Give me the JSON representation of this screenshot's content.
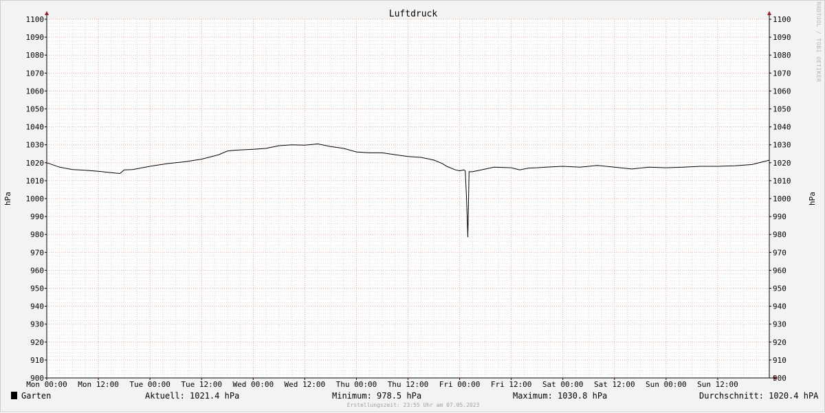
{
  "chart_data": {
    "type": "line",
    "title": "Luftdruck",
    "ylabel": "hPa",
    "ylim": [
      900,
      1100
    ],
    "y_ticks": [
      "900",
      "910",
      "920",
      "930",
      "940",
      "950",
      "960",
      "970",
      "980",
      "990",
      "1000",
      "1010",
      "1020",
      "1030",
      "1040",
      "1050",
      "1060",
      "1070",
      "1080",
      "1090",
      "1100"
    ],
    "x_tick_labels": [
      "Mon 00:00",
      "Mon 12:00",
      "Tue 00:00",
      "Tue 12:00",
      "Wed 00:00",
      "Wed 12:00",
      "Thu 00:00",
      "Thu 12:00",
      "Fri 00:00",
      "Fri 12:00",
      "Sat 00:00",
      "Sat 12:00",
      "Sun 00:00",
      "Sun 12:00"
    ],
    "x_unit": "hours",
    "xlim": [
      0,
      168
    ],
    "grid": true,
    "series": [
      {
        "name": "Garten",
        "color": "#000000",
        "x": [
          0,
          3,
          6,
          9,
          12,
          15,
          17,
          18,
          20,
          24,
          28,
          30,
          32,
          36,
          40,
          42,
          44,
          48,
          51,
          54,
          57,
          60,
          63,
          66,
          69,
          72,
          75,
          78,
          81,
          84,
          87,
          90,
          92,
          93,
          95,
          96,
          97,
          97.3,
          97.6,
          97.9,
          98.2,
          99,
          101,
          104,
          108,
          110,
          112,
          114,
          116,
          120,
          124,
          128,
          132,
          136,
          140,
          144,
          148,
          152,
          156,
          160,
          164,
          168
        ],
        "y": [
          1020.0,
          1017.5,
          1016.2,
          1015.8,
          1015.2,
          1014.5,
          1014.0,
          1016.0,
          1016.2,
          1018.0,
          1019.5,
          1020.0,
          1020.5,
          1022.0,
          1024.5,
          1026.5,
          1027.0,
          1027.5,
          1028.0,
          1029.5,
          1030.0,
          1029.8,
          1030.5,
          1029.0,
          1028.0,
          1026.0,
          1025.5,
          1025.5,
          1024.5,
          1023.5,
          1023.0,
          1021.5,
          1019.5,
          1018.0,
          1016.0,
          1015.5,
          1016.0,
          1015.5,
          1000.0,
          978.5,
          1015.0,
          1015.0,
          1016.0,
          1017.5,
          1017.2,
          1016.0,
          1017.0,
          1017.2,
          1017.5,
          1018.0,
          1017.5,
          1018.5,
          1017.5,
          1016.5,
          1017.5,
          1017.2,
          1017.5,
          1018.0,
          1018.0,
          1018.3,
          1019.0,
          1021.4
        ]
      }
    ]
  },
  "watermark": "RRDTOOL / TOBI OETIKER",
  "legend": {
    "name": "Garten",
    "current": "Aktuell: 1021.4 hPa",
    "minimum": "Minimum: 978.5 hPa",
    "maximum": "Maximum: 1030.8 hPa",
    "average": "Durchschnitt: 1020.4 hPA"
  },
  "created": "Erstellungszeit: 23:55 Uhr am 07.05.2023",
  "colors": {
    "background": "#f3f3f3",
    "plot_background": "#ffffff",
    "major_grid": "#ff9c9c",
    "minor_grid": "#dcdcdc",
    "axis": "#000000",
    "axis_arrow": "#9c1b1b"
  }
}
